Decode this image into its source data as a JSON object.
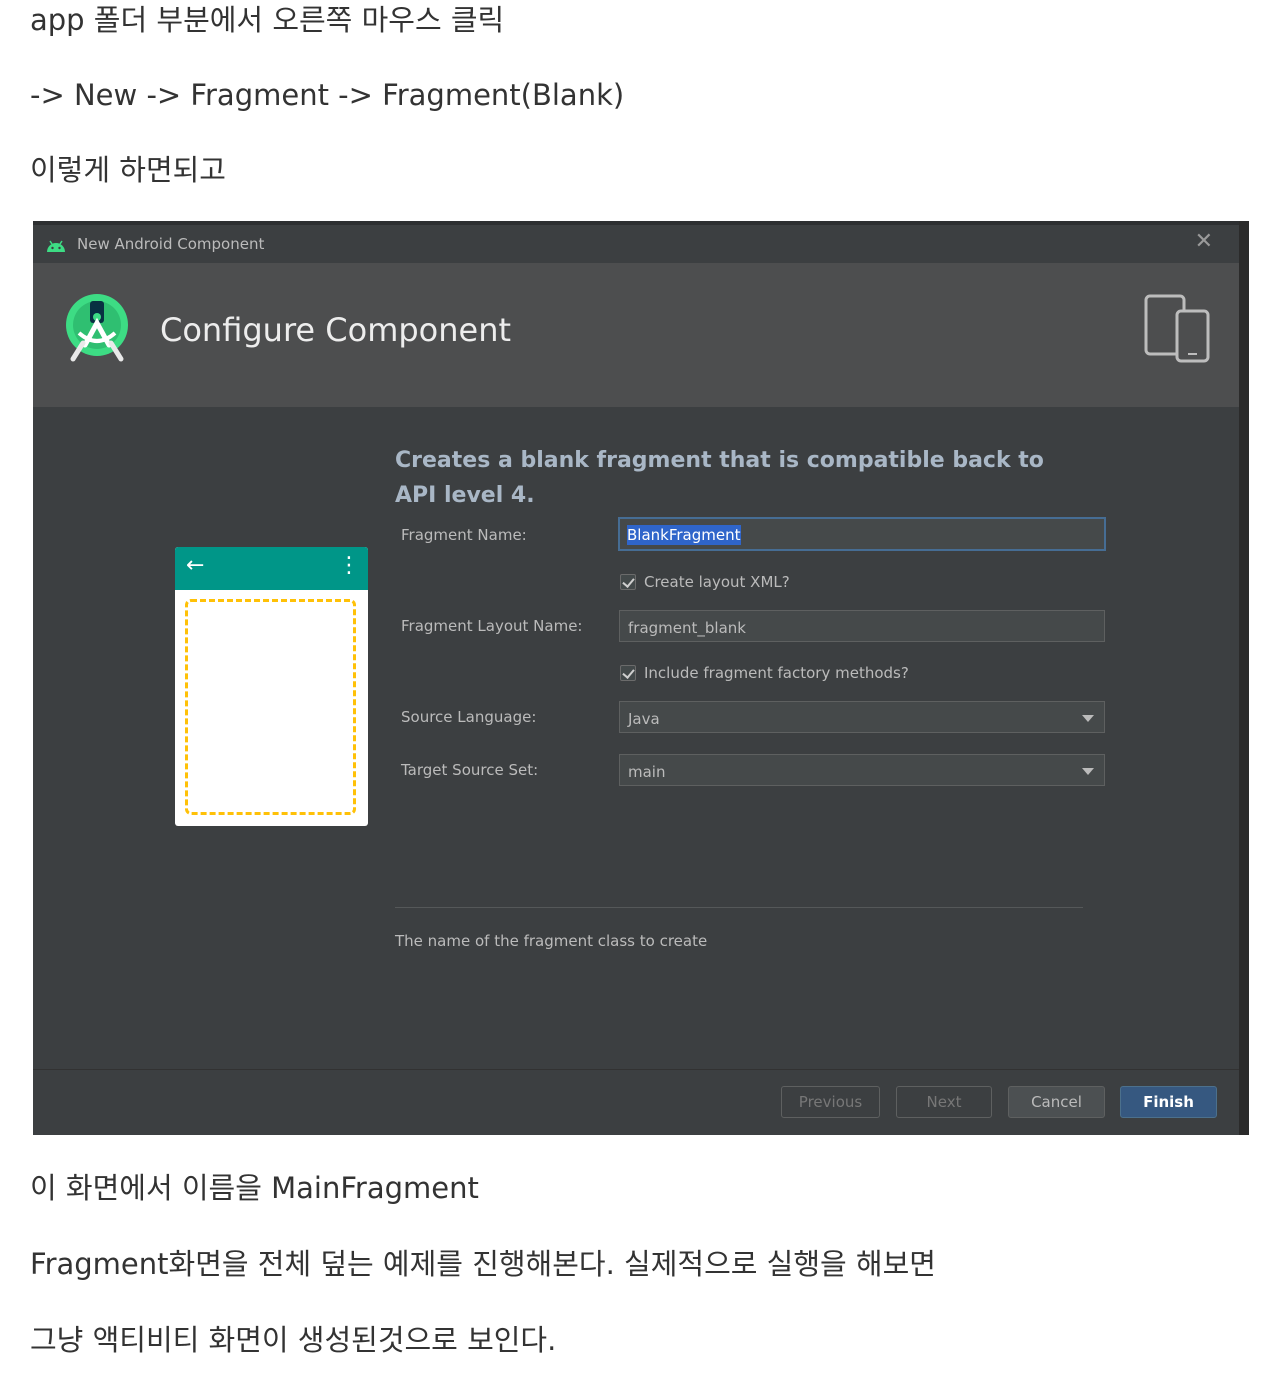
{
  "article": {
    "line1": "app 폴더 부분에서 오른쪽 마우스 클릭",
    "line2": "-> New  -> Fragment -> Fragment(Blank)",
    "line3": "이렇게 하면되고",
    "line4": "이 화면에서 이름을 MainFragment",
    "line5": "Fragment화면을 전체 덮는 예제를 진행해본다. 실제적으로 실행을 해보면",
    "line6": "그냥 액티비티 화면이 생성된것으로 보인다."
  },
  "dialog": {
    "window_title": "New Android Component",
    "close_glyph": "✕",
    "heading": "Configure Component",
    "description": "Creates a blank fragment that is compatible back to API level 4.",
    "fields": {
      "fragment_name_label": "Fragment Name:",
      "fragment_name_value": "BlankFragment",
      "create_layout_label": "Create layout XML?",
      "create_layout_checked": true,
      "layout_name_label": "Fragment Layout Name:",
      "layout_name_value": "fragment_blank",
      "factory_methods_label": "Include fragment factory methods?",
      "factory_methods_checked": true,
      "source_language_label": "Source Language:",
      "source_language_value": "Java",
      "target_source_set_label": "Target Source Set:",
      "target_source_set_value": "main"
    },
    "help_text": "The name of the fragment class to create",
    "buttons": {
      "previous": "Previous",
      "next": "Next",
      "cancel": "Cancel",
      "finish": "Finish"
    },
    "preview": {
      "back_glyph": "←",
      "menu_glyph": "⋮"
    },
    "colors": {
      "appbar": "#009688",
      "fragment_outline": "#ffc107",
      "android_green": "#3ddc84",
      "primary_button": "#365880"
    }
  }
}
